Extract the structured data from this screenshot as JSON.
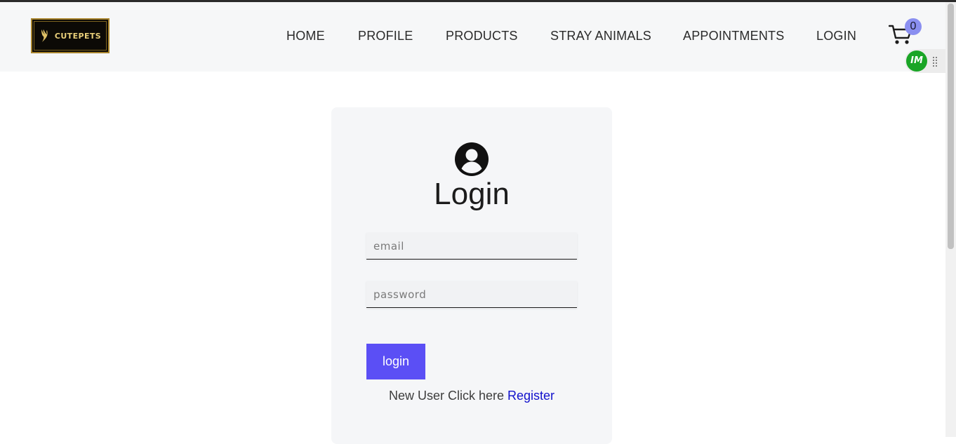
{
  "brand": {
    "logo_text": "CUTEPETS"
  },
  "nav": {
    "items": [
      {
        "label": "HOME"
      },
      {
        "label": "PROFILE"
      },
      {
        "label": "PRODUCTS"
      },
      {
        "label": "STRAY ANIMALS"
      },
      {
        "label": "APPOINTMENTS"
      },
      {
        "label": "LOGIN"
      }
    ],
    "cart": {
      "icon": "cart-icon",
      "count": "0",
      "badge_color": "#8a8ff0"
    }
  },
  "extension": {
    "icon": "extension-logo-icon",
    "label": "IM",
    "color": "#1aa526"
  },
  "login": {
    "icon": "user-circle-icon",
    "title": "Login",
    "email_placeholder": "email",
    "password_placeholder": "password",
    "button_label": "login",
    "button_color": "#5b4ff5",
    "register_prompt": "New User Click here",
    "register_link": "Register"
  }
}
